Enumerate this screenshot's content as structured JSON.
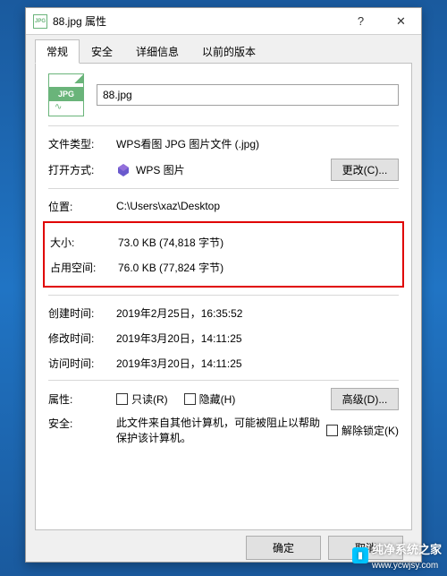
{
  "titlebar": {
    "title": "88.jpg 属性"
  },
  "tabs": {
    "general": "常规",
    "security": "安全",
    "details": "详细信息",
    "previous": "以前的版本"
  },
  "file": {
    "icon_label": "JPG",
    "name": "88.jpg"
  },
  "labels": {
    "filetype": "文件类型:",
    "opens_with": "打开方式:",
    "location": "位置:",
    "size": "大小:",
    "size_on_disk": "占用空间:",
    "created": "创建时间:",
    "modified": "修改时间:",
    "accessed": "访问时间:",
    "attributes": "属性:",
    "security_label": "安全:"
  },
  "values": {
    "filetype": "WPS看图 JPG 图片文件 (.jpg)",
    "opens_with": "WPS 图片",
    "location": "C:\\Users\\xaz\\Desktop",
    "size": "73.0 KB (74,818 字节)",
    "size_on_disk": "76.0 KB (77,824 字节)",
    "created": "2019年2月25日，16:35:52",
    "modified": "2019年3月20日，14:11:25",
    "accessed": "2019年3月20日，14:11:25",
    "security_text": "此文件来自其他计算机，可能被阻止以帮助保护该计算机。"
  },
  "buttons": {
    "change": "更改(C)...",
    "advanced": "高级(D)...",
    "ok": "确定",
    "cancel": "取消"
  },
  "checkboxes": {
    "readonly": "只读(R)",
    "hidden": "隐藏(H)",
    "unblock": "解除锁定(K)"
  },
  "watermark": {
    "text": "纯净系统之家",
    "url": "www.ycwjsy.com"
  }
}
